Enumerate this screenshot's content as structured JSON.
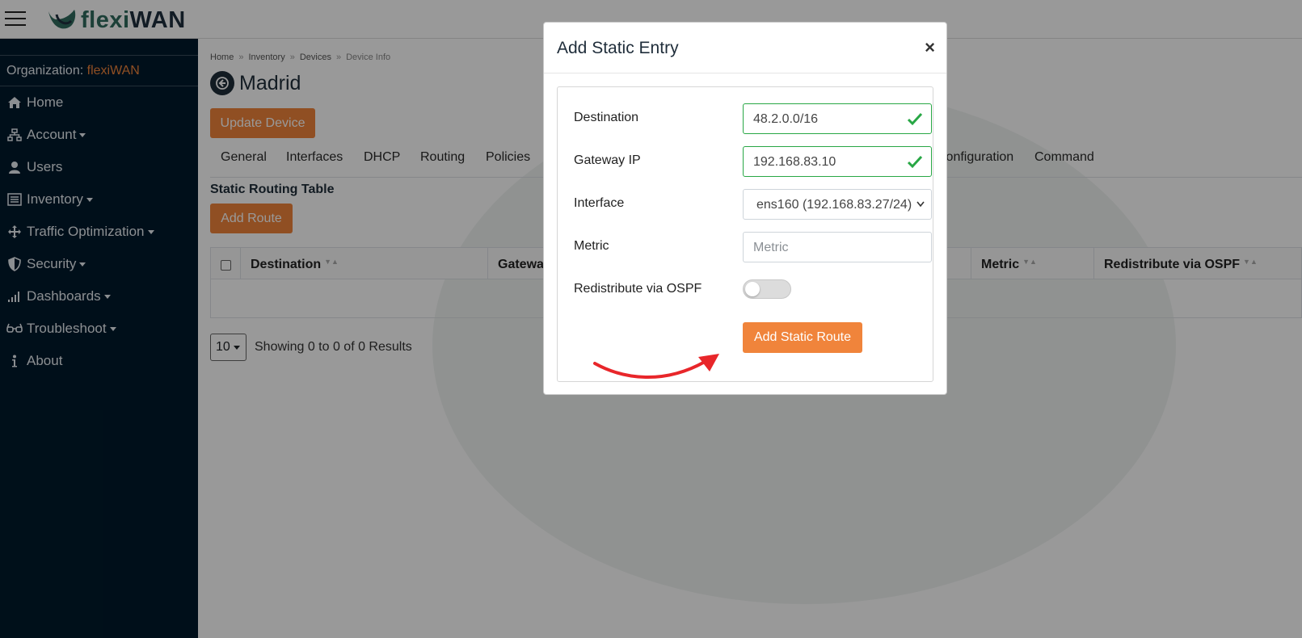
{
  "header": {
    "brand_light": "flexi",
    "brand_dark": "WAN",
    "menu_icon": "hamburger-icon"
  },
  "sidebar": {
    "org_label": "Organization:",
    "org_value": "flexiWAN",
    "items": [
      {
        "label": "Home",
        "icon": "home-icon",
        "dropdown": false
      },
      {
        "label": "Account",
        "icon": "sitemap-icon",
        "dropdown": true
      },
      {
        "label": "Users",
        "icon": "user-icon",
        "dropdown": false
      },
      {
        "label": "Inventory",
        "icon": "list-icon",
        "dropdown": true
      },
      {
        "label": "Traffic Optimization",
        "icon": "arrows-icon",
        "dropdown": true
      },
      {
        "label": "Security",
        "icon": "shield-icon",
        "dropdown": true
      },
      {
        "label": "Dashboards",
        "icon": "signal-icon",
        "dropdown": true
      },
      {
        "label": "Troubleshoot",
        "icon": "glasses-icon",
        "dropdown": true
      },
      {
        "label": "About",
        "icon": "info-icon",
        "dropdown": false
      }
    ]
  },
  "breadcrumb": {
    "home": "Home",
    "inventory": "Inventory",
    "devices": "Devices",
    "current": "Device Info",
    "separator": "»"
  },
  "page": {
    "title": "Madrid",
    "update_button": "Update Device",
    "tabs": [
      "General",
      "Interfaces",
      "DHCP",
      "Routing",
      "Policies",
      "Configuration",
      "Command"
    ],
    "section_title": "Static Routing Table",
    "add_route_button": "Add Route"
  },
  "table": {
    "columns": [
      "Destination",
      "Gatewa",
      "Metric",
      "Redistribute via OSPF"
    ]
  },
  "pager": {
    "page_size": "10",
    "summary": "Showing 0 to 0 of 0 Results"
  },
  "modal": {
    "title": "Add Static Entry",
    "close": "×",
    "fields": {
      "destination": {
        "label": "Destination",
        "value": "48.2.0.0/16"
      },
      "gateway": {
        "label": "Gateway IP",
        "value": "192.168.83.10"
      },
      "interface": {
        "label": "Interface",
        "value": "ens160 (192.168.83.27/24)"
      },
      "metric": {
        "label": "Metric",
        "placeholder": "Metric"
      },
      "ospf": {
        "label": "Redistribute via OSPF",
        "enabled": false
      }
    },
    "submit": "Add Static Route"
  },
  "colors": {
    "accent": "#f0843b",
    "sidebar_bg": "#001a2c",
    "valid": "#28a745",
    "annotation_arrow": "#e8262a"
  }
}
